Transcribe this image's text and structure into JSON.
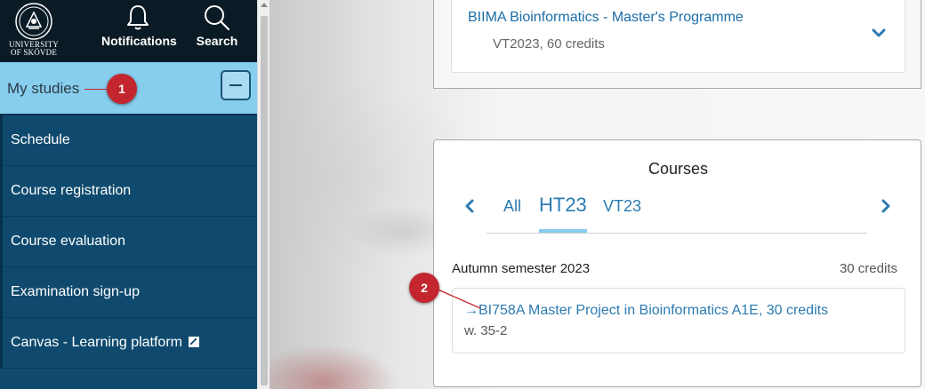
{
  "sidebar": {
    "logo": {
      "line1": "UNIVERSITY",
      "line2": "OF SKÖVDE"
    },
    "top_buttons": {
      "notifications": "Notifications",
      "search": "Search"
    },
    "section": {
      "label": "My studies",
      "collapse_symbol": "−"
    },
    "menu": [
      {
        "label": "Schedule"
      },
      {
        "label": "Course registration"
      },
      {
        "label": "Course evaluation"
      },
      {
        "label": "Examination sign-up"
      },
      {
        "label": "Canvas - Learning platform",
        "icon": "external-link-icon"
      }
    ]
  },
  "programme": {
    "title": "BIIMA Bioinformatics - Master's Programme",
    "subtitle": "VT2023, 60 credits",
    "expand_icon": "chevron-down-icon"
  },
  "courses": {
    "title": "Courses",
    "tabs": [
      "All",
      "HT23",
      "VT23"
    ],
    "active_tab": "HT23",
    "semester": {
      "label": "Autumn semester 2023",
      "credits": "30 credits",
      "course": {
        "arrow": "→",
        "name": "BI758A Master Project in Bioinformatics A1E, 30 credits",
        "weeks": "w. 35-2"
      }
    }
  },
  "annotations": {
    "marker1": "1",
    "marker2": "2"
  },
  "colors": {
    "sidebar": "#0f4a6e",
    "topbar": "#0b1b25",
    "section": "#87cdee",
    "link": "#2b7bb1",
    "marker": "#c3262e"
  }
}
